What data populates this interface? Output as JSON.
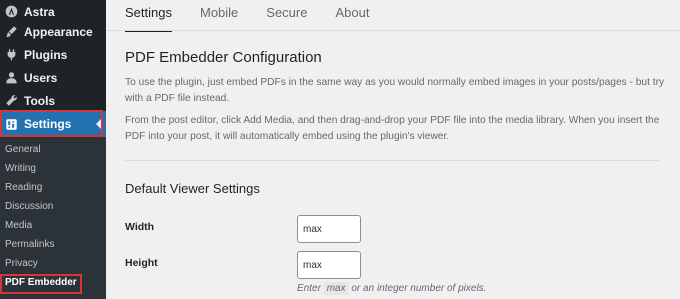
{
  "sidebar": {
    "menu": [
      {
        "label": "Astra",
        "icon": "astra-icon"
      },
      {
        "label": "Appearance",
        "icon": "paintbrush-icon"
      },
      {
        "label": "Plugins",
        "icon": "plugin-icon"
      },
      {
        "label": "Users",
        "icon": "users-icon"
      },
      {
        "label": "Tools",
        "icon": "wrench-icon"
      },
      {
        "label": "Settings",
        "icon": "settings-icon"
      }
    ],
    "submenu": [
      {
        "label": "General"
      },
      {
        "label": "Writing"
      },
      {
        "label": "Reading"
      },
      {
        "label": "Discussion"
      },
      {
        "label": "Media"
      },
      {
        "label": "Permalinks"
      },
      {
        "label": "Privacy"
      },
      {
        "label": "PDF Embedder"
      }
    ]
  },
  "tabs": [
    "Settings",
    "Mobile",
    "Secure",
    "About"
  ],
  "main": {
    "title": "PDF Embedder Configuration",
    "para1_line1": "To use the plugin, just embed PDFs in the same way as you would normally embed images in your posts/pages - but try",
    "para1_line2": "with a PDF file instead.",
    "para2_line1": "From the post editor, click Add Media, and then drag-and-drop your PDF file into the media library. When you insert the",
    "para2_line2": "PDF into your post, it will automatically embed using the plugin's viewer.",
    "section_title": "Default Viewer Settings",
    "width_label": "Width",
    "width_value": "max",
    "height_label": "Height",
    "height_value": "max",
    "hint_pre": "Enter",
    "hint_code": "max",
    "hint_post": "or an integer number of pixels."
  },
  "colors": {
    "sidebar_bg": "#1d2327",
    "submenu_bg": "#2c3338",
    "accent": "#2271b1",
    "highlight_outline": "#d63638"
  }
}
